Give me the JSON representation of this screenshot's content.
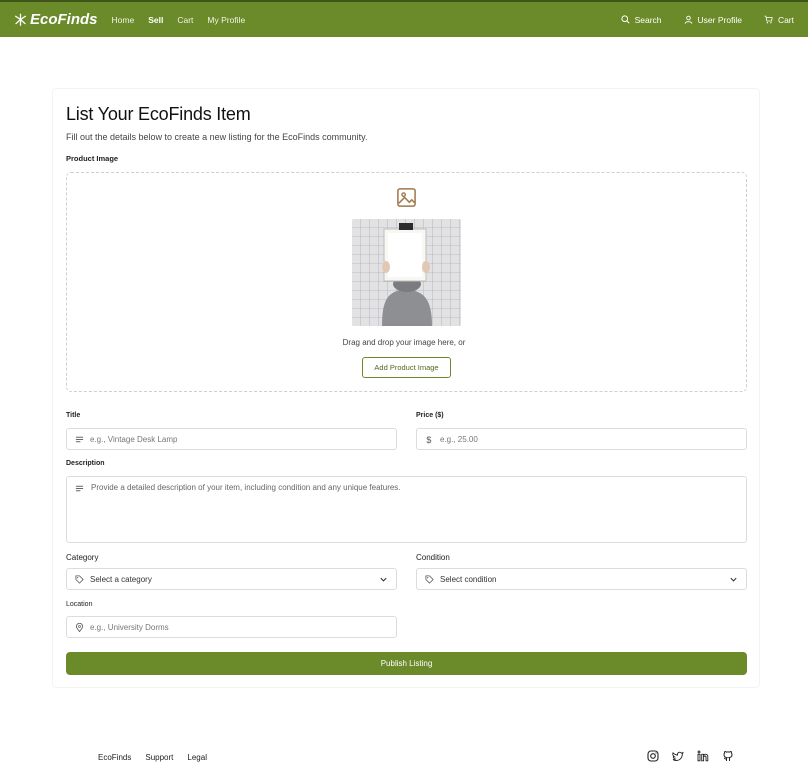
{
  "app": {
    "brand": "EcoFinds",
    "accent": "#6b8a2a"
  },
  "nav": {
    "items": [
      "Home",
      "Sell",
      "Cart",
      "My Profile"
    ],
    "active": "Sell",
    "search_label": "Search",
    "profile_label": "User Profile",
    "cart_label": "Cart"
  },
  "form": {
    "title": "List Your EcoFinds Item",
    "subtitle": "Fill out the details below to create a new listing for the EcoFinds community.",
    "image_label": "Product Image",
    "drag_text": "Drag and drop your image here, or",
    "add_image_button": "Add Product Image",
    "title_label": "Title",
    "title_placeholder": "e.g., Vintage Desk Lamp",
    "price_label": "Price ($)",
    "price_placeholder": "e.g., 25.00",
    "description_label": "Description",
    "description_placeholder": "Provide a detailed description of your item, including condition and any unique features.",
    "category_label": "Category",
    "category_placeholder": "Select a category",
    "condition_label": "Condition",
    "condition_placeholder": "Select condition",
    "location_label": "Location",
    "location_placeholder": "e.g., University Dorms",
    "publish_button": "Publish Listing"
  },
  "footer": {
    "links": [
      "EcoFinds",
      "Support",
      "Legal"
    ],
    "social_icons": [
      "instagram-icon",
      "twitter-icon",
      "linkedin-icon",
      "github-icon"
    ]
  }
}
